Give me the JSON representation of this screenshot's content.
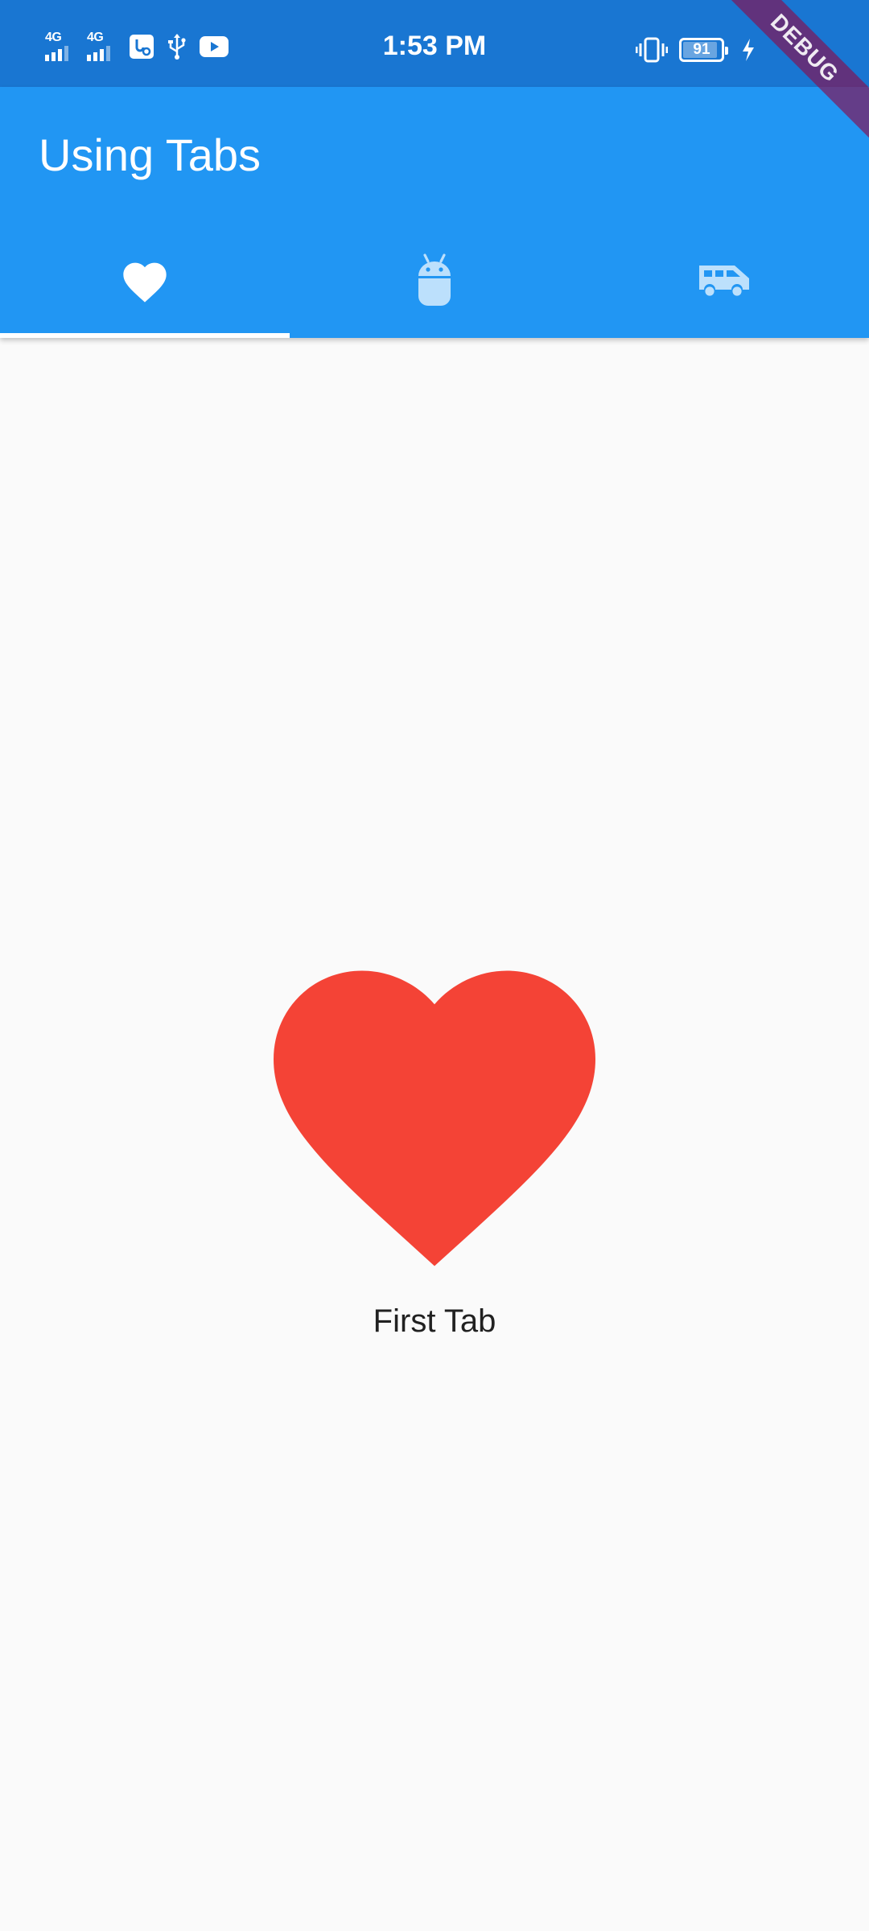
{
  "status_bar": {
    "time": "1:53 PM",
    "sim1_network": "4G",
    "sim2_network": "4G",
    "battery_level": "91",
    "icons": [
      "signal-icon",
      "signal-icon",
      "usb-settings-icon",
      "usb-icon",
      "youtube-icon",
      "vibrate-icon",
      "battery-icon",
      "charging-icon"
    ]
  },
  "app_bar": {
    "title": "Using Tabs",
    "background_color": "#2196f3",
    "status_bar_color": "#1976d2"
  },
  "tabs": [
    {
      "icon": "favorite-icon",
      "selected": true
    },
    {
      "icon": "android-icon",
      "selected": false
    },
    {
      "icon": "airport-shuttle-icon",
      "selected": false
    }
  ],
  "debug_banner": {
    "label": "DEBUG"
  },
  "content": {
    "label": "First Tab",
    "icon": "favorite-icon",
    "icon_color": "#f44336"
  }
}
